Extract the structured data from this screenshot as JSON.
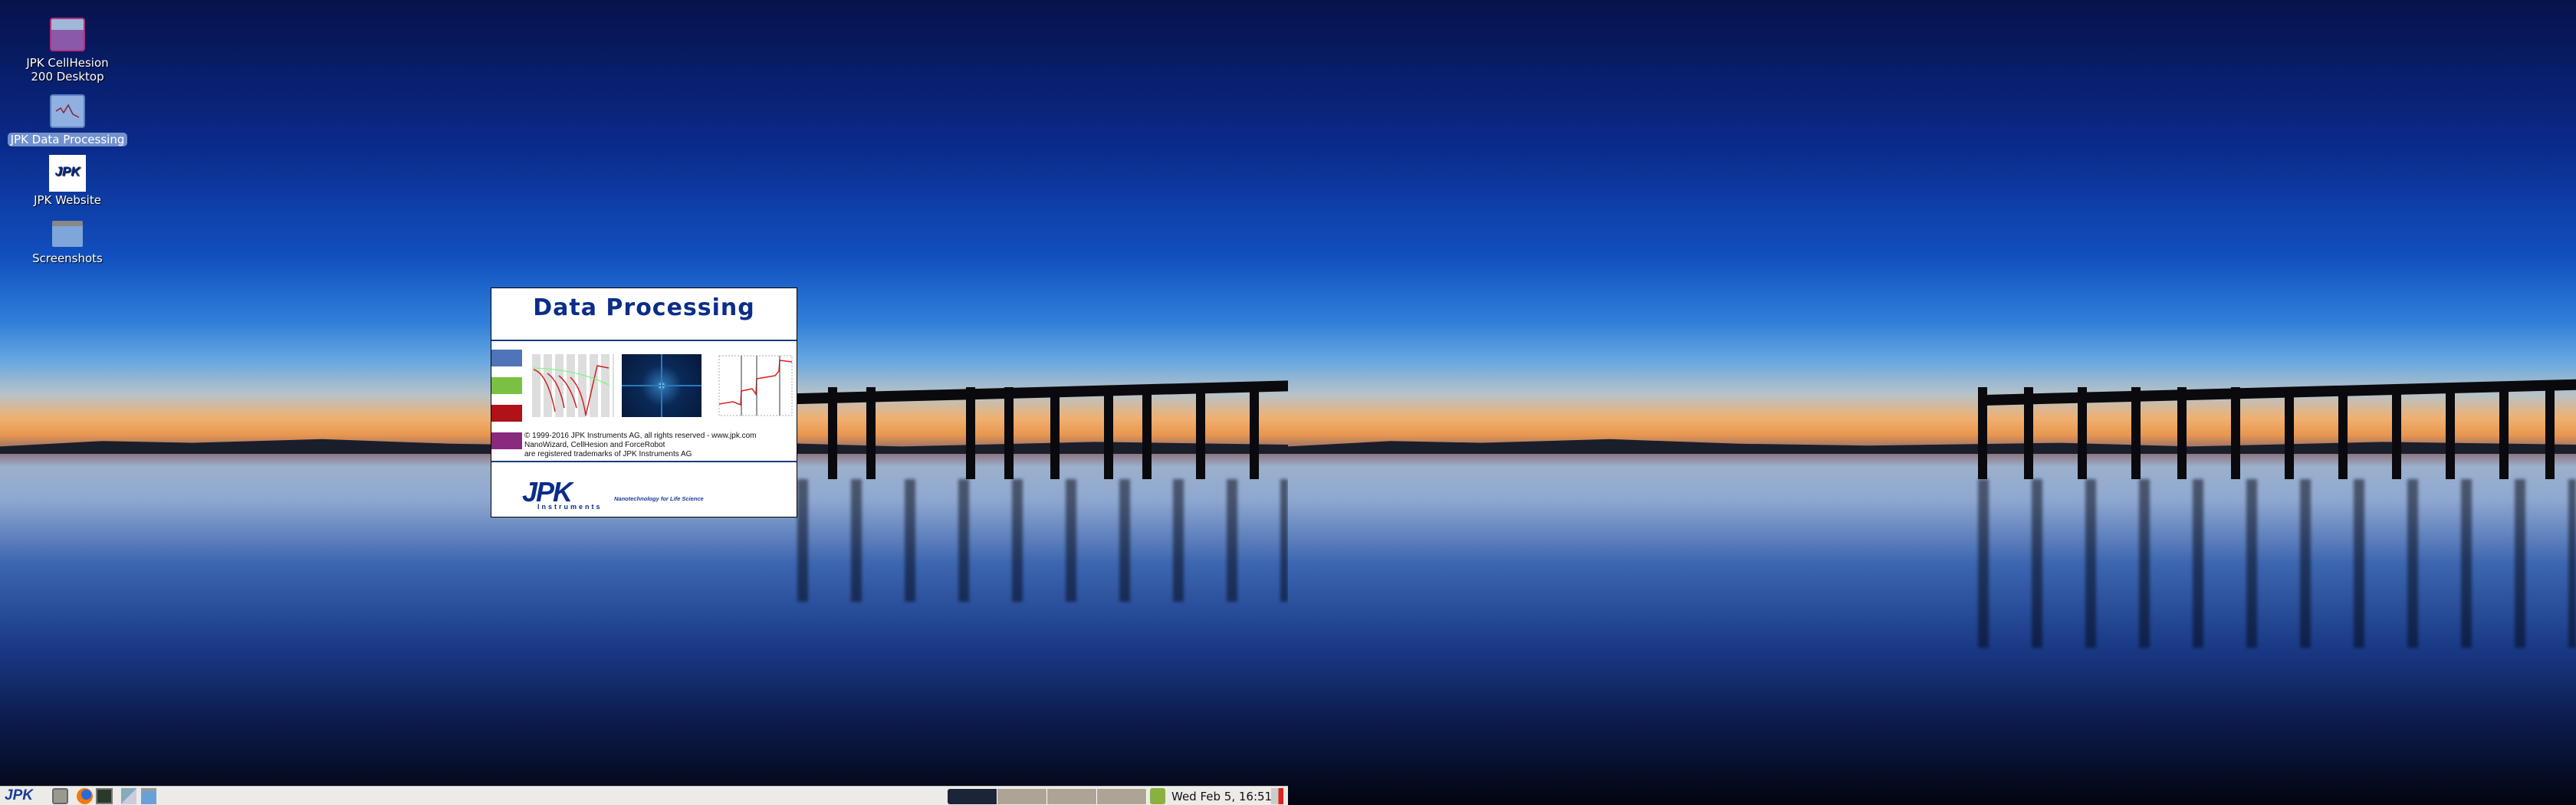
{
  "desktop": {
    "icons": [
      {
        "label": "JPK CellHesion 200 Desktop",
        "line1": "JPK CellHesion",
        "line2": "200 Desktop",
        "icon": "cellhesion-app-icon"
      },
      {
        "label": "JPK Data Processing",
        "icon": "data-processing-app-icon",
        "selected": true
      },
      {
        "label": "JPK Website",
        "icon": "jpk-logo-icon"
      },
      {
        "label": "Screenshots",
        "icon": "folder-icon"
      }
    ]
  },
  "splash": {
    "title": "Data Processing",
    "bar_colors": [
      "#4f74b8",
      "#7ac143",
      "#b01218",
      "#8a2a7e"
    ],
    "copyright": "© 1999-2016 JPK Instruments AG, all rights reserved - www.jpk.com",
    "trademark1": "NanoWizard, CellHesion and ForceRobot",
    "trademark2": "are registered trademarks of JPK Instruments AG",
    "logo": "JPK",
    "logo_sub": "Instruments",
    "tagline": "Nanotechnology for Life Science"
  },
  "taskbar": {
    "menu_logo": "JPK",
    "launchers": [
      "show-desktop-icon",
      "firefox-icon",
      "terminal-icon",
      "network-icon",
      "files-icon"
    ],
    "workspaces": 4,
    "current_workspace": 1,
    "clock": "Wed Feb  5, 16:51",
    "trash": "trash-icon",
    "logout": "logout-icon"
  }
}
